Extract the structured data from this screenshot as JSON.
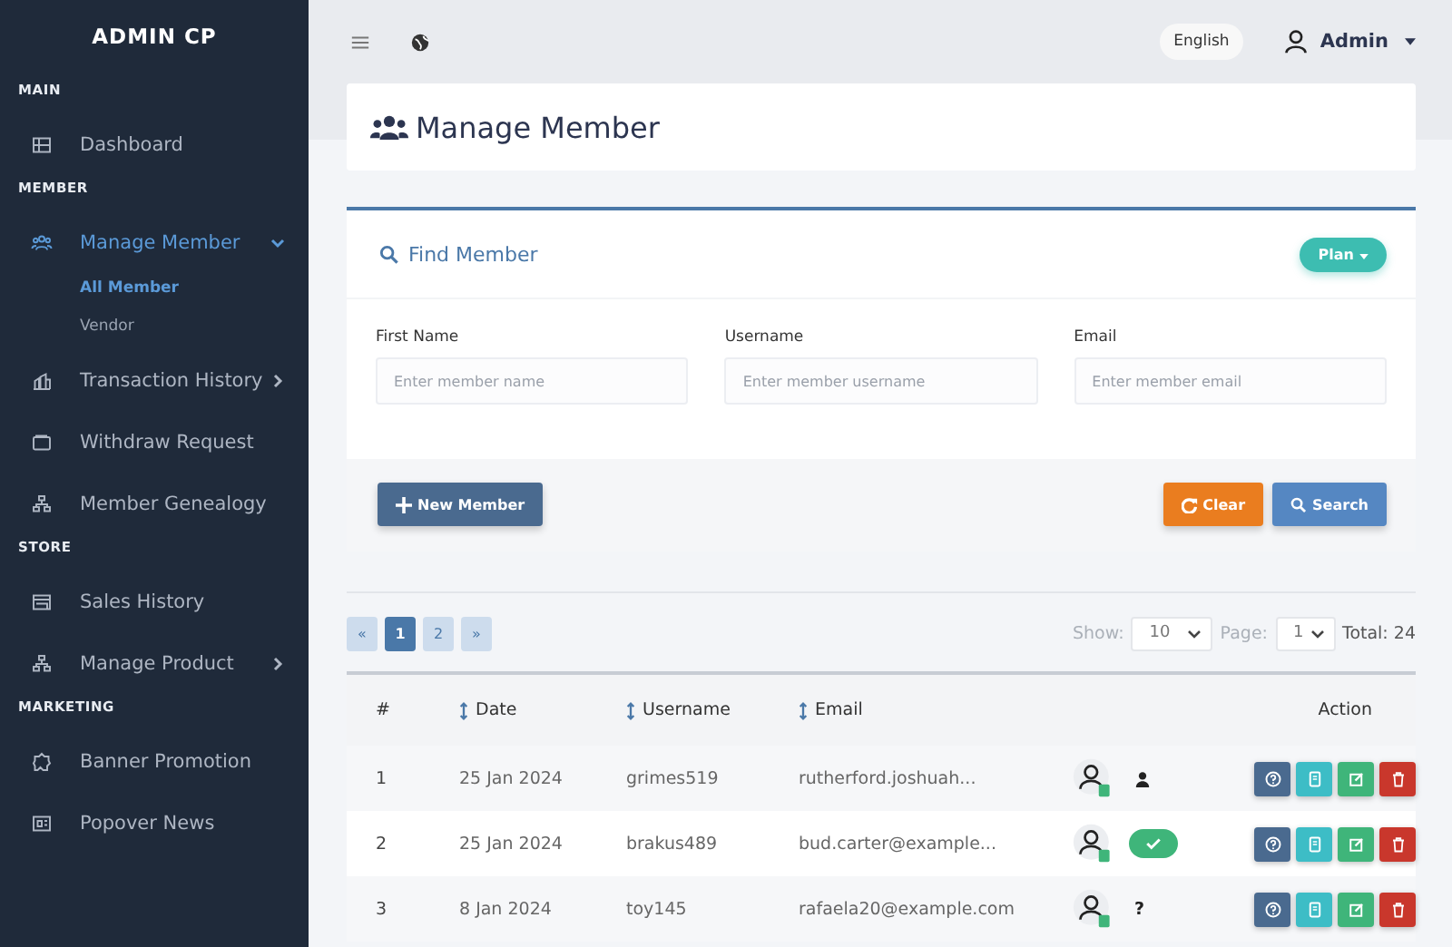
{
  "sidebar": {
    "brand": "ADMIN CP",
    "sections": [
      {
        "title": "MAIN",
        "items": [
          {
            "label": "Dashboard",
            "kind": "dashboard",
            "selected": false,
            "expandable": false
          }
        ]
      },
      {
        "title": "MEMBER",
        "items": [
          {
            "label": "Manage Member",
            "kind": "members",
            "selected": true,
            "expandable": true,
            "expanded": true,
            "children": [
              {
                "label": "All Member",
                "selected": true
              },
              {
                "label": "Vendor",
                "selected": false
              }
            ]
          },
          {
            "label": "Transaction History",
            "kind": "chart",
            "selected": false,
            "expandable": true,
            "expanded": false
          },
          {
            "label": "Withdraw Request",
            "kind": "wallet",
            "selected": false,
            "expandable": false
          },
          {
            "label": "Member Genealogy",
            "kind": "tree",
            "selected": false,
            "expandable": false
          }
        ]
      },
      {
        "title": "STORE",
        "items": [
          {
            "label": "Sales History",
            "kind": "store",
            "selected": false,
            "expandable": false
          },
          {
            "label": "Manage Product",
            "kind": "tree",
            "selected": false,
            "expandable": true,
            "expanded": false
          }
        ]
      },
      {
        "title": "MARKETING",
        "items": [
          {
            "label": "Banner Promotion",
            "kind": "badge",
            "selected": false,
            "expandable": false
          },
          {
            "label": "Popover News",
            "kind": "news",
            "selected": false,
            "expandable": false
          }
        ]
      }
    ]
  },
  "topbar": {
    "language": "English",
    "user": "Admin"
  },
  "page_title": "Manage Member",
  "find": {
    "title": "Find Member",
    "plan_button": "Plan",
    "fields": [
      {
        "label": "First Name",
        "placeholder": "Enter member name"
      },
      {
        "label": "Username",
        "placeholder": "Enter member username"
      },
      {
        "label": "Email",
        "placeholder": "Enter member email"
      }
    ],
    "new_button": "New Member",
    "clear_button": "Clear",
    "search_button": "Search"
  },
  "pagination": {
    "prev": "«",
    "pages": [
      {
        "label": "1",
        "selected": true
      },
      {
        "label": "2",
        "selected": false
      }
    ],
    "next": "»",
    "show_label": "Show:",
    "show_value": "10",
    "page_label": "Page:",
    "page_value": "1",
    "total": "Total: 24"
  },
  "table": {
    "columns": [
      {
        "label": "#",
        "sortable": false
      },
      {
        "label": "Date",
        "sortable": true
      },
      {
        "label": "Username",
        "sortable": true
      },
      {
        "label": "Email",
        "sortable": true
      },
      {
        "label": "Action",
        "sortable": false
      }
    ],
    "rows": [
      {
        "no": "1",
        "date": "25 Jan 2024",
        "username": "grimes519",
        "email": "rutherford.joshuah...",
        "status": {
          "kind": "user"
        }
      },
      {
        "no": "2",
        "date": "25 Jan 2024",
        "username": "brakus489",
        "email": "bud.carter@example...",
        "status": {
          "kind": "verified"
        }
      },
      {
        "no": "3",
        "date": "8 Jan 2024",
        "username": "toy145",
        "email": "rafaela20@example.com",
        "status": {
          "kind": "unknown",
          "text": "?"
        }
      }
    ]
  }
}
